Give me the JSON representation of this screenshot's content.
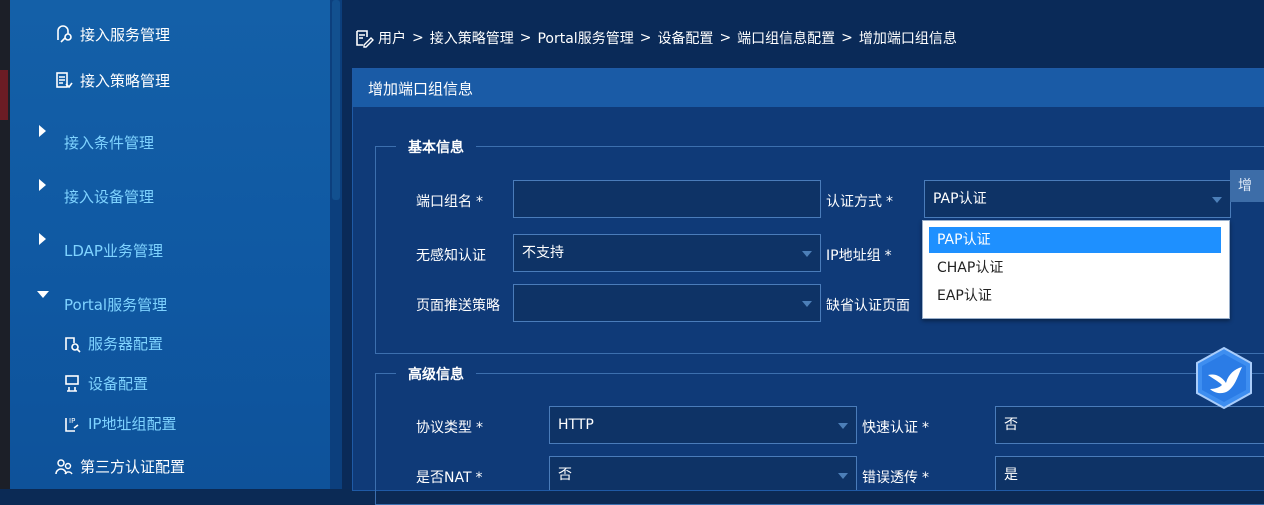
{
  "sidebar": {
    "items": [
      {
        "label": "接入服务管理",
        "icon": "service-icon"
      },
      {
        "label": "接入策略管理",
        "icon": "policy-icon"
      },
      {
        "label": "接入条件管理",
        "icon": "caret-right-icon"
      },
      {
        "label": "接入设备管理",
        "icon": "caret-right-icon"
      },
      {
        "label": "LDAP业务管理",
        "icon": "caret-right-icon"
      },
      {
        "label": "Portal服务管理",
        "icon": "caret-down-icon"
      },
      {
        "label": "服务器配置",
        "icon": "server-config-icon"
      },
      {
        "label": "设备配置",
        "icon": "device-config-icon"
      },
      {
        "label": "IP地址组配置",
        "icon": "ip-group-icon"
      },
      {
        "label": "第三方认证配置",
        "icon": "users-icon"
      }
    ]
  },
  "breadcrumb": [
    "用户",
    "接入策略管理",
    "Portal服务管理",
    "设备配置",
    "端口组信息配置",
    "增加端口组信息"
  ],
  "breadcrumb_sep": ">",
  "panel": {
    "title": "增加端口组信息",
    "basic_legend": "基本信息",
    "advanced_legend": "高级信息",
    "required_mark": "*",
    "fields": {
      "port_group_name": {
        "label": "端口组名",
        "value": ""
      },
      "auth_method": {
        "label": "认证方式",
        "value": "PAP认证"
      },
      "unaware_auth": {
        "label": "无感知认证",
        "value": "不支持"
      },
      "ip_group": {
        "label": "IP地址组"
      },
      "page_push_policy": {
        "label": "页面推送策略",
        "value": ""
      },
      "default_auth_page": {
        "label": "缺省认证页面"
      },
      "protocol_type": {
        "label": "协议类型",
        "value": "HTTP"
      },
      "quick_auth": {
        "label": "快速认证",
        "value": "否"
      },
      "is_nat": {
        "label": "是否NAT",
        "value": "否"
      },
      "error_passthrough": {
        "label": "错误透传",
        "value": "是"
      }
    },
    "partial_button": "增"
  },
  "dropdown": {
    "options": [
      "PAP认证",
      "CHAP认证",
      "EAP认证"
    ],
    "selected": "PAP认证"
  },
  "colors": {
    "accent": "#1e90ff",
    "sidebar": "#1460a8",
    "panel": "#0f3a78",
    "link": "#7fd3ff"
  }
}
